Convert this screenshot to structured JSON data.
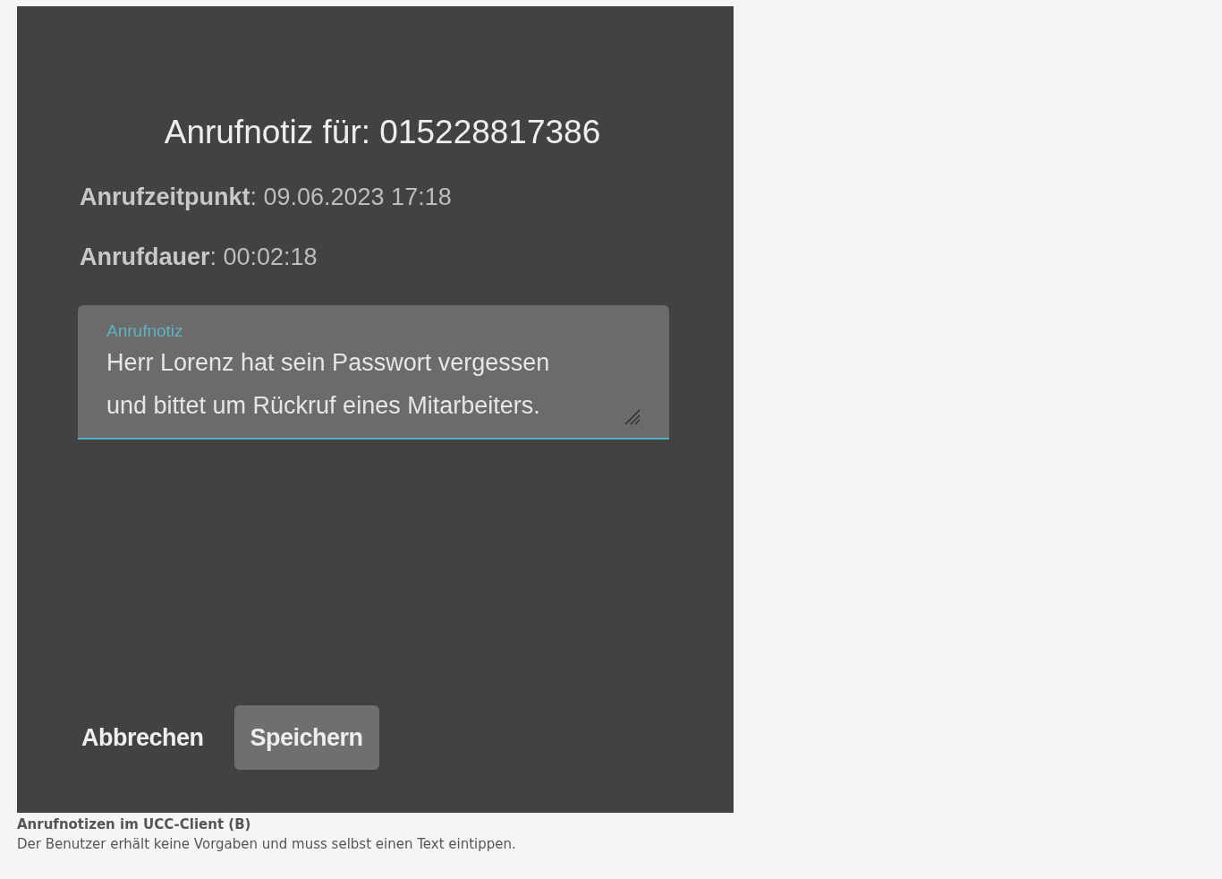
{
  "dialog": {
    "title": "Anrufnotiz für: 015228817386",
    "details": [
      "**Anrufzeitpunkt**: 09.06.2023 17:18",
      "**Anrufdauer**: 00:02:18"
    ],
    "note_field": {
      "label": "Anrufnotiz",
      "value": "Herr Lorenz hat sein Passwort vergessen\nund bittet um Rückruf eines Mitarbeiters.",
      "focused": true
    },
    "buttons": [
      {
        "label": "Abbrechen",
        "kind": "text"
      },
      {
        "label": "Speichern",
        "kind": "filled"
      }
    ]
  },
  "caption": {
    "title": "Anrufnotizen im UCC-Client (B)",
    "text": "Der Benutzer erhält keine Vorgaben und muss selbst einen Text eintippen."
  }
}
